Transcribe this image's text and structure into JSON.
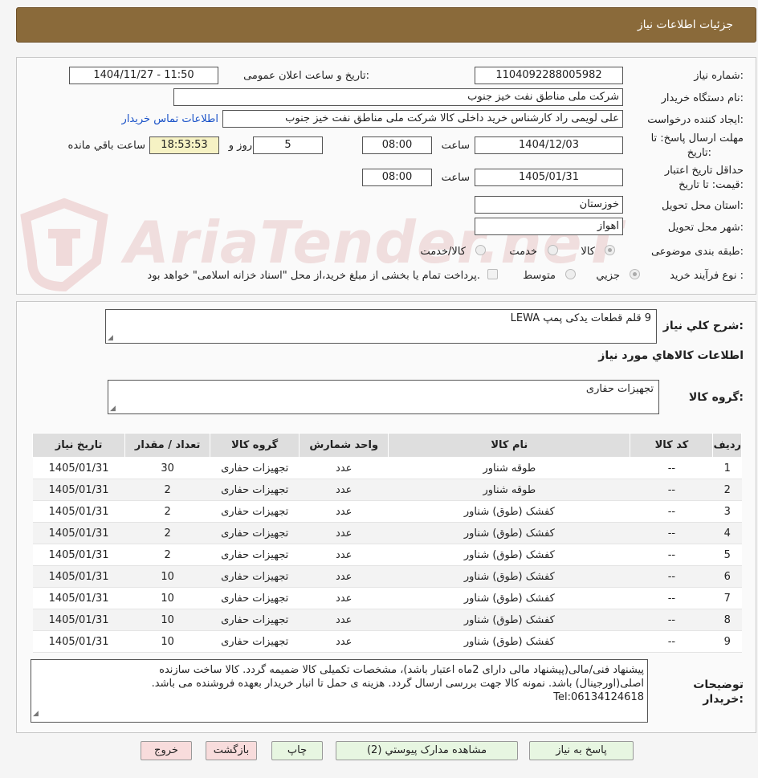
{
  "header": {
    "title": "جزئیات اطلاعات نیاز"
  },
  "watermark": {
    "text": "AriaTender.neT"
  },
  "form": {
    "need_number_label": "شماره نیاز:",
    "need_number": "1104092288005982",
    "announce_label": "تاریخ و ساعت اعلان عمومی:",
    "announce_value": "1404/11/27 - 11:50",
    "buyer_org_label": "نام دستگاه خریدار:",
    "buyer_org": "شرکت ملی مناطق نفت خیز جنوب",
    "requester_label": "ایجاد کننده درخواست:",
    "requester": "علی  لویمی راد  کارشناس خرید داخلی کالا شرکت ملی مناطق نفت خیز جنوب",
    "contact_link": "اطلاعات تماس خریدار",
    "deadline_label_1": "مهلت ارسال پاسخ: تا",
    "deadline_label_2": "تاریخ:",
    "deadline_date": "1404/12/03",
    "time_label": "ساعت",
    "deadline_time": "08:00",
    "days_value": "5",
    "days_label": "روز و",
    "remaining_time": "18:53:53",
    "remaining_label": "ساعت باقي مانده",
    "validity_label_1": "حداقل تاریخ اعتبار",
    "validity_label_2": "قیمت: تا تاریخ:",
    "validity_date": "1405/01/31",
    "validity_time": "08:00",
    "province_label": "استان محل تحویل:",
    "province": "خوزستان",
    "city_label": "شهر محل تحویل:",
    "city": "اهواز",
    "category_label": "طبقه بندی موضوعی:",
    "category_options": [
      "کالا",
      "خدمت",
      "کالا/خدمت"
    ],
    "process_label": "نوع فرآیند خرید :",
    "process_options": [
      "جزیي",
      "متوسط"
    ],
    "payment_note": "پرداخت تمام یا بخشی از مبلغ خرید،از محل \"اسناد خزانه اسلامی\" خواهد بود."
  },
  "details": {
    "summary_label": "شرح کلي نياز:",
    "summary": "9 قلم قطعات یدکی پمپ  LEWA",
    "goods_info_title": "اطلاعات كالاهاي مورد نياز",
    "goods_group_label": "گروه کالا:",
    "goods_group": "تجهیزات حفاری"
  },
  "table": {
    "headers": [
      "رديف",
      "کد کالا",
      "نام کالا",
      "واحد شمارش",
      "گروه کالا",
      "تعداد / مقدار",
      "تاریخ نیاز"
    ],
    "rows": [
      [
        "1",
        "--",
        "طوقه شناور",
        "عدد",
        "تجهیزات حفاری",
        "30",
        "1405/01/31"
      ],
      [
        "2",
        "--",
        "طوقه شناور",
        "عدد",
        "تجهیزات حفاری",
        "2",
        "1405/01/31"
      ],
      [
        "3",
        "--",
        "کفشک (طوق) شناور",
        "عدد",
        "تجهیزات حفاری",
        "2",
        "1405/01/31"
      ],
      [
        "4",
        "--",
        "کفشک (طوق) شناور",
        "عدد",
        "تجهیزات حفاری",
        "2",
        "1405/01/31"
      ],
      [
        "5",
        "--",
        "کفشک (طوق) شناور",
        "عدد",
        "تجهیزات حفاری",
        "2",
        "1405/01/31"
      ],
      [
        "6",
        "--",
        "کفشک (طوق) شناور",
        "عدد",
        "تجهیزات حفاری",
        "10",
        "1405/01/31"
      ],
      [
        "7",
        "--",
        "کفشک (طوق) شناور",
        "عدد",
        "تجهیزات حفاری",
        "10",
        "1405/01/31"
      ],
      [
        "8",
        "--",
        "کفشک (طوق) شناور",
        "عدد",
        "تجهیزات حفاری",
        "10",
        "1405/01/31"
      ],
      [
        "9",
        "--",
        "کفشک (طوق) شناور",
        "عدد",
        "تجهیزات حفاری",
        "10",
        "1405/01/31"
      ]
    ]
  },
  "notes": {
    "label_1": "توضیحات",
    "label_2": "خریدار:",
    "line1": "پیشنهاد فنی/مالی(پیشنهاد مالی دارای 2ماه اعتبار باشد)، مشخصات تکمیلی کالا ضمیمه گردد. کالا ساخت سازنده",
    "line2": "اصلی(اورجینال) باشد. نمونه کالا جهت بررسی ارسال گردد. هزینه ی حمل تا انبار خریدار بعهده فروشنده می باشد.",
    "line3": "Tel:06134124618"
  },
  "buttons": {
    "reply": "پاسخ به نیاز",
    "attachments": "مشاهده مدارک پیوستي (2)",
    "print": "چاپ",
    "back": "بازگشت",
    "exit": "خروج"
  }
}
